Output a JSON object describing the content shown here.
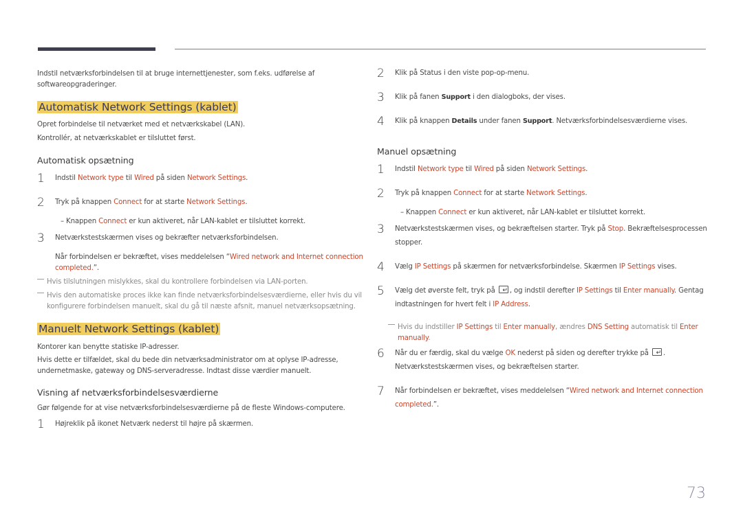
{
  "page_number": "73",
  "left": {
    "intro": "Indstil netværksforbindelsen til at bruge internettjenester, som f.eks. udførelse af softwareopgraderinger.",
    "auto_section": {
      "title": "Automatisk Network Settings (kablet)",
      "p1": "Opret forbindelse til netværket med et netværkskabel (LAN).",
      "p2": "Kontrollér, at netværkskablet er tilsluttet først.",
      "subtitle": "Automatisk opsætning",
      "steps": [
        {
          "n": "1",
          "parts": [
            "Indstil ",
            "Network type",
            " til ",
            "Wired",
            " på siden ",
            "Network Settings",
            "."
          ]
        },
        {
          "n": "2",
          "parts": [
            "Tryk på knappen ",
            "Connect",
            " for at starte ",
            "Network Settings",
            "."
          ]
        },
        {
          "n": "3",
          "parts": [
            "Netværkstestskærmen vises og bekræfter netværksforbindelsen."
          ]
        }
      ],
      "sub_note": [
        "–  Knappen ",
        "Connect",
        " er kun aktiveret, når LAN-kablet er tilsluttet korrekt."
      ],
      "confirm": [
        "Når forbindelsen er bekræftet, vises meddelelsen “",
        "Wired network and Internet connection completed.",
        "”."
      ],
      "notes": [
        "Hvis tilslutningen mislykkes, skal du kontrollere forbindelsen via LAN-porten.",
        "Hvis den automatiske proces ikke kan finde netværksforbindelsesværdierne, eller hvis du vil konfigurere forbindelsen manuelt, skal du gå til næste afsnit, manuel netværksopsætning."
      ]
    },
    "manual_section": {
      "title": "Manuelt Network Settings (kablet)",
      "p1": "Kontorer kan benytte statiske IP-adresser.",
      "p2": "Hvis dette er tilfældet, skal du bede din netværksadministrator om at oplyse IP-adresse, undernetmaske, gateway og DNS-serveradresse. Indtast disse værdier manuelt.",
      "subtitle": "Visning af netværksforbindelsesværdierne",
      "p3": "Gør følgende for at vise netværksforbindelsesværdierne på de fleste Windows-computere.",
      "step1": {
        "n": "1",
        "text": "Højreklik på ikonet Netværk nederst til højre på skærmen."
      }
    }
  },
  "right": {
    "steps_top": [
      {
        "n": "2",
        "parts": [
          "Klik på Status i den viste pop-op-menu."
        ]
      },
      {
        "n": "3",
        "parts": [
          "Klik på fanen ",
          "Support",
          " i den dialogboks, der vises."
        ]
      },
      {
        "n": "4",
        "parts": [
          "Klik på knappen ",
          "Details",
          " under fanen ",
          "Support",
          ". Netværksforbindelsesværdierne vises."
        ]
      }
    ],
    "manual_subtitle": "Manuel opsætning",
    "manual_steps": [
      {
        "n": "1",
        "parts": [
          "Indstil ",
          "Network type",
          " til ",
          "Wired",
          " på siden ",
          "Network Settings",
          "."
        ]
      },
      {
        "n": "2",
        "parts": [
          "Tryk på knappen ",
          "Connect",
          " for at starte ",
          "Network Settings",
          "."
        ]
      },
      {
        "n": "3",
        "parts": [
          "Netværkstestskærmen vises, og bekræftelsen starter. Tryk på ",
          "Stop",
          ". Bekræftelsesprocessen stopper."
        ]
      },
      {
        "n": "4",
        "parts": [
          "Vælg ",
          "IP Settings",
          " på skærmen for netværksforbindelse. Skærmen ",
          "IP Settings",
          " vises."
        ]
      },
      {
        "n": "5",
        "parts": [
          "Vælg det øverste felt, tryk på ",
          "ENTER_ICON",
          ", og indstil derefter ",
          "IP Settings",
          " til ",
          "Enter manually",
          ". Gentag indtastningen for hvert felt i ",
          "IP Address",
          "."
        ]
      },
      {
        "n": "6",
        "parts": [
          "Når du er færdig, skal du vælge ",
          "OK",
          " nederst på siden og derefter trykke på ",
          "ENTER_ICON",
          ". Netværkstestskærmen vises, og bekræftelsen starter."
        ]
      },
      {
        "n": "7",
        "parts": [
          "Når forbindelsen er bekræftet, vises meddelelsen “",
          "Wired network and Internet connection completed.",
          "”."
        ]
      }
    ],
    "sub_note": [
      "–  Knappen ",
      "Connect",
      " er kun aktiveret, når LAN-kablet er tilsluttet korrekt."
    ],
    "note5": [
      "Hvis du indstiller ",
      "IP Settings",
      " til ",
      "Enter manually",
      ", ændres ",
      "DNS Setting",
      " automatisk til ",
      "Enter manually",
      "."
    ]
  },
  "colors": {
    "highlight": "#c9462c",
    "heading_bg": "#f0cd5c",
    "heading_text": "#3a3a5a"
  }
}
